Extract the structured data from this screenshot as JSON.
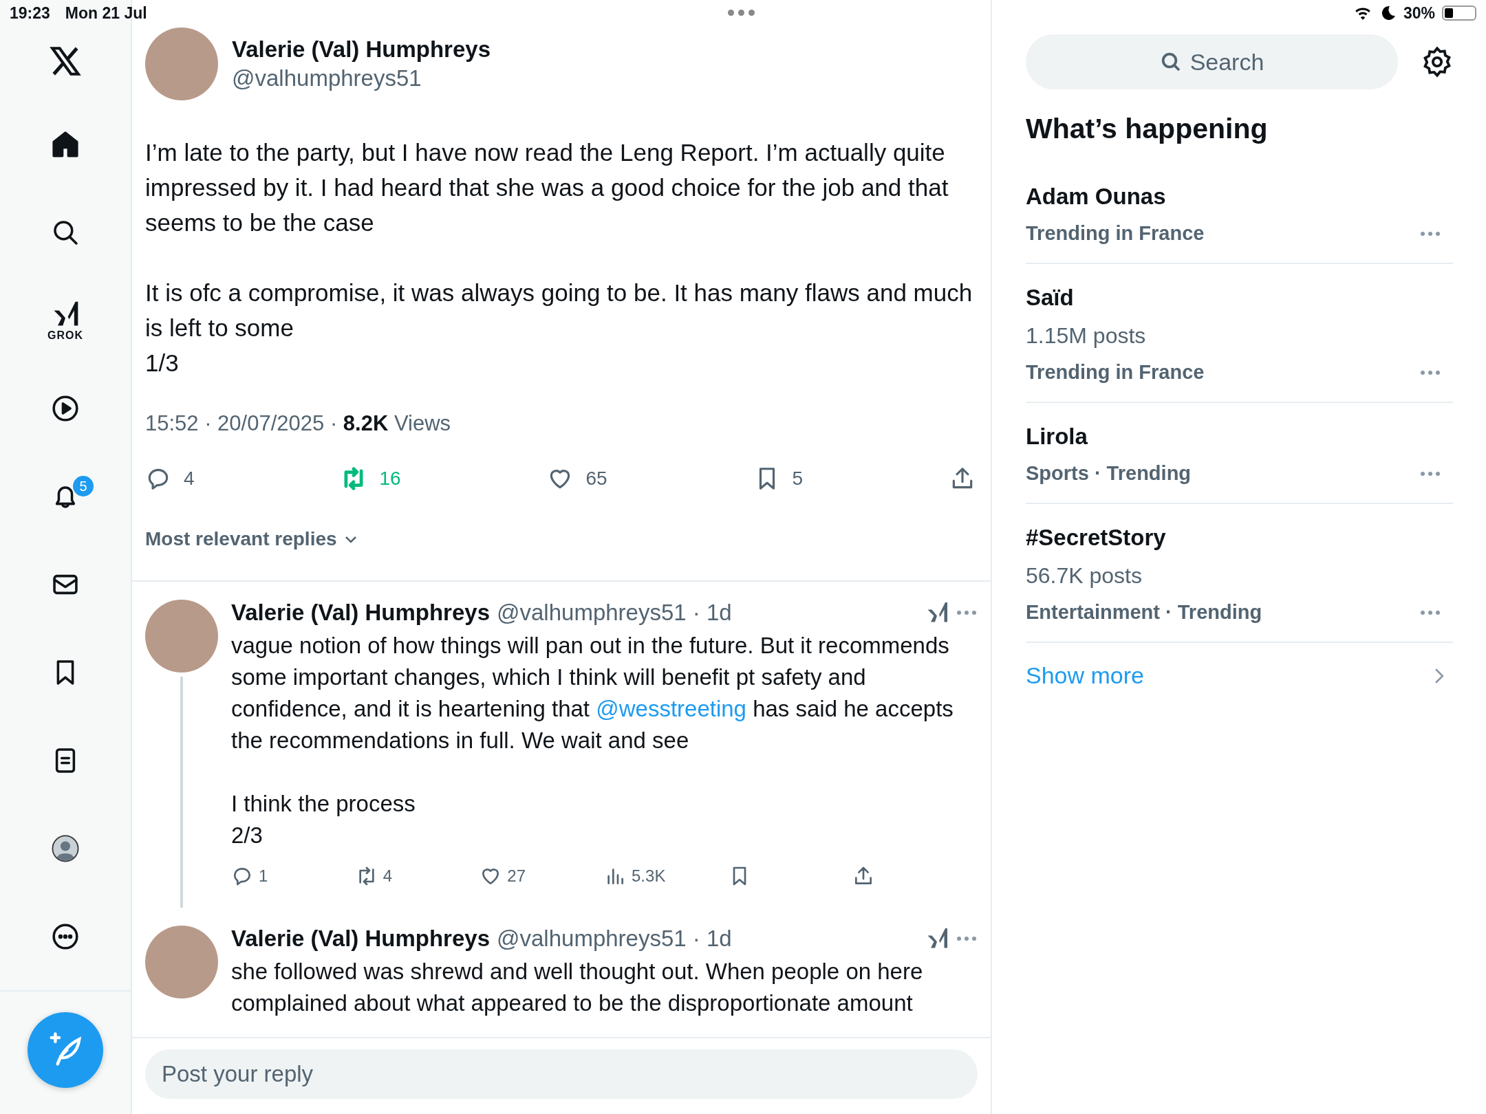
{
  "status_bar": {
    "time": "19:23",
    "date": "Mon 21 Jul",
    "battery": "30%"
  },
  "sidebar": {
    "items": [
      {
        "kind": "home",
        "selected": true
      },
      {
        "kind": "search",
        "selected": false
      },
      {
        "kind": "grok",
        "label": "GROK",
        "selected": false
      },
      {
        "kind": "video",
        "selected": false
      },
      {
        "kind": "notifications",
        "badge": "5",
        "selected": false
      },
      {
        "kind": "messages",
        "selected": false
      },
      {
        "kind": "bookmarks",
        "selected": false
      },
      {
        "kind": "lists",
        "selected": false
      },
      {
        "kind": "profile",
        "selected": false
      },
      {
        "kind": "more",
        "selected": false
      }
    ]
  },
  "tweet": {
    "author": {
      "name": "Valerie (Val) Humphreys",
      "handle": "@valhumphreys51"
    },
    "paragraphs": [
      "I’m late to the party, but I have now read the Leng Report. I’m actually quite impressed by it. I had heard that she was a good choice for the job and that seems to be the case",
      "It is ofc a compromise, it was always going to be. It has many flaws and much is left to some\n1/3"
    ],
    "meta": "15:52 · 20/07/2025 · **8.2K** Views",
    "actions": [
      {
        "kind": "reply",
        "count": "4",
        "active": false
      },
      {
        "kind": "repost",
        "count": "16",
        "active": true
      },
      {
        "kind": "like",
        "count": "65",
        "active": false
      },
      {
        "kind": "bookmark",
        "count": "5",
        "active": false
      },
      {
        "kind": "share",
        "active": false
      }
    ]
  },
  "replies_sort": "Most relevant replies",
  "replies": [
    {
      "name": "Valerie (Val) Humphreys",
      "meta": "@valhumphreys51 · 1d",
      "connected": true,
      "paragraphs": [
        [
          {
            "text": "vague notion of how things will pan out in the future. But it recommends some important changes, which I think will benefit pt safety and confidence, and it is heartening that "
          },
          {
            "text": "@wesstreeting",
            "kind": "mention"
          },
          {
            "text": " has said he accepts the recommendations in full. We wait and see"
          }
        ],
        [
          {
            "text": "I think the process\n2/3"
          }
        ]
      ],
      "actions": [
        {
          "kind": "reply",
          "count": "1"
        },
        {
          "kind": "repost",
          "count": "4"
        },
        {
          "kind": "like",
          "count": "27"
        },
        {
          "kind": "views",
          "count": "5.3K"
        },
        {
          "kind": "bookmark"
        },
        {
          "kind": "share"
        }
      ]
    },
    {
      "name": "Valerie (Val) Humphreys",
      "meta": "@valhumphreys51 · 1d",
      "connected": false,
      "paragraphs": [
        [
          {
            "text": "she followed was shrewd and well thought out. When people on here complained about what appeared to be the disproportionate amount"
          }
        ]
      ]
    }
  ],
  "reply_box": {
    "placeholder": "Post your reply"
  },
  "right": {
    "search": {
      "placeholder": "Search"
    },
    "heading": "What’s happening",
    "trends": [
      {
        "name": "Adam Ounas",
        "context": "Trending in France"
      },
      {
        "name": "Saïd",
        "posts": "1.15M posts",
        "context": "Trending in France"
      },
      {
        "name": "Lirola",
        "context": "Sports · Trending"
      },
      {
        "name": "#SecretStory",
        "posts": "56.7K posts",
        "context": "Entertainment · Trending"
      }
    ],
    "show_more": "Show more"
  }
}
